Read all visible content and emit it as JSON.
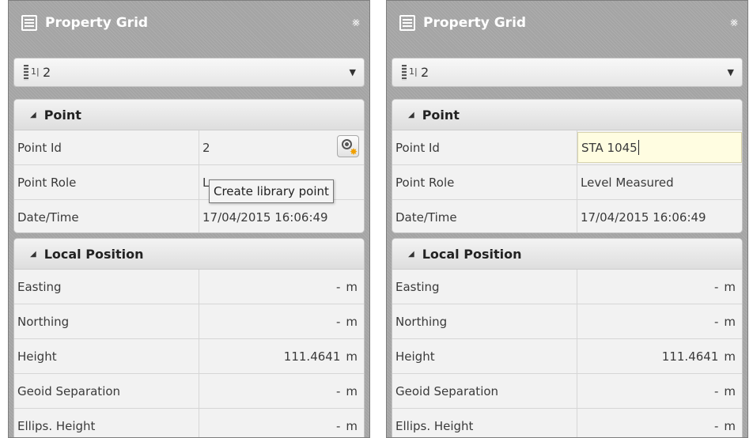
{
  "panels": [
    {
      "title": "Property Grid",
      "selector": {
        "value": "2"
      },
      "point": {
        "header": "Point",
        "rows": [
          {
            "label": "Point Id",
            "value": "2"
          },
          {
            "label": "Point Role",
            "value": "Le"
          },
          {
            "label": "Date/Time",
            "value": "17/04/2015 16:06:49"
          }
        ]
      },
      "local_position": {
        "header": "Local Position",
        "rows": [
          {
            "label": "Easting",
            "value": "-",
            "unit": "m"
          },
          {
            "label": "Northing",
            "value": "-",
            "unit": "m"
          },
          {
            "label": "Height",
            "value": "111.4641",
            "unit": "m"
          },
          {
            "label": "Geoid Separation",
            "value": "-",
            "unit": "m"
          },
          {
            "label": "Ellips. Height",
            "value": "-",
            "unit": "m"
          }
        ]
      },
      "tooltip": "Create library point"
    },
    {
      "title": "Property Grid",
      "selector": {
        "value": "2"
      },
      "point": {
        "header": "Point",
        "rows": [
          {
            "label": "Point Id",
            "value": "STA 1045"
          },
          {
            "label": "Point Role",
            "value": "Level Measured"
          },
          {
            "label": "Date/Time",
            "value": "17/04/2015 16:06:49"
          }
        ]
      },
      "local_position": {
        "header": "Local Position",
        "rows": [
          {
            "label": "Easting",
            "value": "-",
            "unit": "m"
          },
          {
            "label": "Northing",
            "value": "-",
            "unit": "m"
          },
          {
            "label": "Height",
            "value": "111.4641",
            "unit": "m"
          },
          {
            "label": "Geoid Separation",
            "value": "-",
            "unit": "m"
          },
          {
            "label": "Ellips. Height",
            "value": "-",
            "unit": "m"
          }
        ]
      }
    }
  ],
  "icons": {
    "title": "property-grid-icon",
    "close": "close-icon",
    "selector": "sort-list-icon",
    "dropdown": "chevron-down-icon",
    "collapse": "collapse-triangle-icon",
    "library": "create-library-point-icon"
  }
}
